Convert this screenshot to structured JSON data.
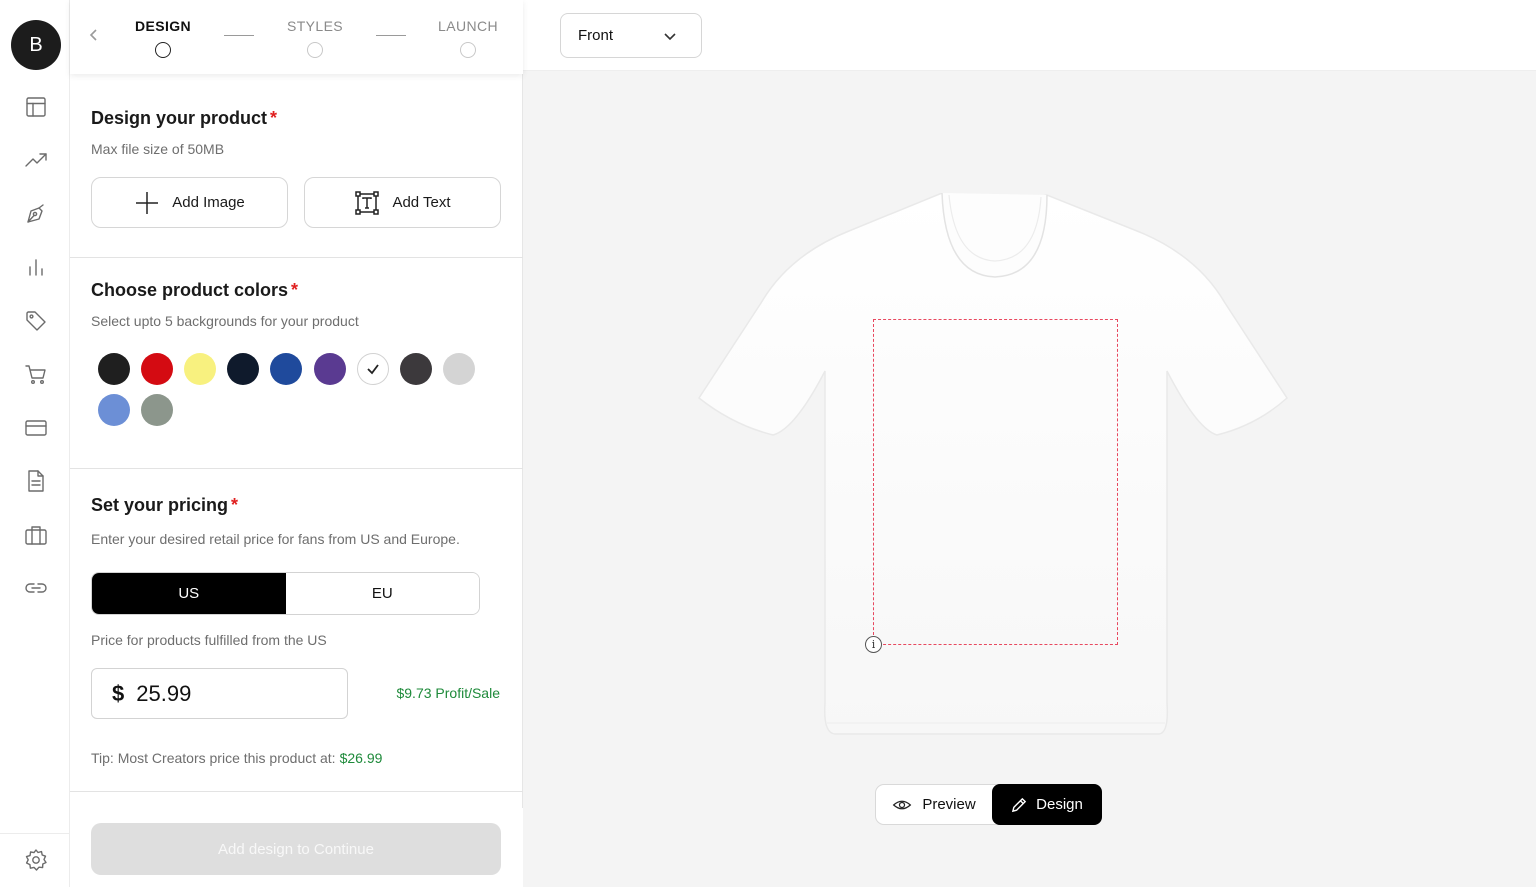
{
  "user": {
    "avatar_initial": "B"
  },
  "rail": {
    "icons": [
      "layout-icon",
      "trending-up-icon",
      "pen-tool-icon",
      "bar-chart-icon",
      "tag-icon",
      "cart-icon",
      "credit-card-icon",
      "document-icon",
      "briefcase-icon",
      "link-icon"
    ],
    "settings_icon": "gear-icon"
  },
  "stepper": {
    "steps": [
      {
        "label": "DESIGN",
        "state": "active"
      },
      {
        "label": "STYLES",
        "state": "inactive"
      },
      {
        "label": "LAUNCH",
        "state": "inactive"
      }
    ]
  },
  "design": {
    "title": "Design your product",
    "required_mark": "*",
    "subtitle": "Max file size of 50MB",
    "add_image_label": "Add Image",
    "add_text_label": "Add Text"
  },
  "colors": {
    "title": "Choose product colors",
    "required_mark": "*",
    "subtitle": "Select upto 5 backgrounds for your product",
    "swatches": [
      {
        "hex": "#1f1f1f",
        "selected": false
      },
      {
        "hex": "#d40b12",
        "selected": false
      },
      {
        "hex": "#f8f17f",
        "selected": false
      },
      {
        "hex": "#0f1a2c",
        "selected": false
      },
      {
        "hex": "#1f4a9c",
        "selected": false
      },
      {
        "hex": "#5a3a91",
        "selected": false
      },
      {
        "hex": "#ffffff",
        "selected": true
      },
      {
        "hex": "#3c393c",
        "selected": false
      },
      {
        "hex": "#d4d4d4",
        "selected": false
      },
      {
        "hex": "#6c8fd6",
        "selected": false
      },
      {
        "hex": "#8c968c",
        "selected": false
      }
    ]
  },
  "pricing": {
    "title": "Set your pricing",
    "required_mark": "*",
    "subtitle": "Enter your desired retail price for fans from US and Europe.",
    "region_us": "US",
    "region_eu": "EU",
    "selected_region": "US",
    "fulfilled_note": "Price for products fulfilled from the US",
    "currency_symbol": "$",
    "price_value": "25.99",
    "profit_text": "$9.73 Profit/Sale",
    "tip_text": "Tip: Most Creators price this product at:",
    "tip_price": "$26.99"
  },
  "footer": {
    "continue_label": "Add design to Continue",
    "continue_enabled": false
  },
  "canvas": {
    "view_select": "Front",
    "info_glyph": "i",
    "preview_label": "Preview",
    "design_label": "Design",
    "active_mode": "Design"
  },
  "colors_theme": {
    "accent": "#000000",
    "required": "#e02020",
    "profit_green": "#1e8a3a",
    "print_area_border": "#e8485f"
  }
}
